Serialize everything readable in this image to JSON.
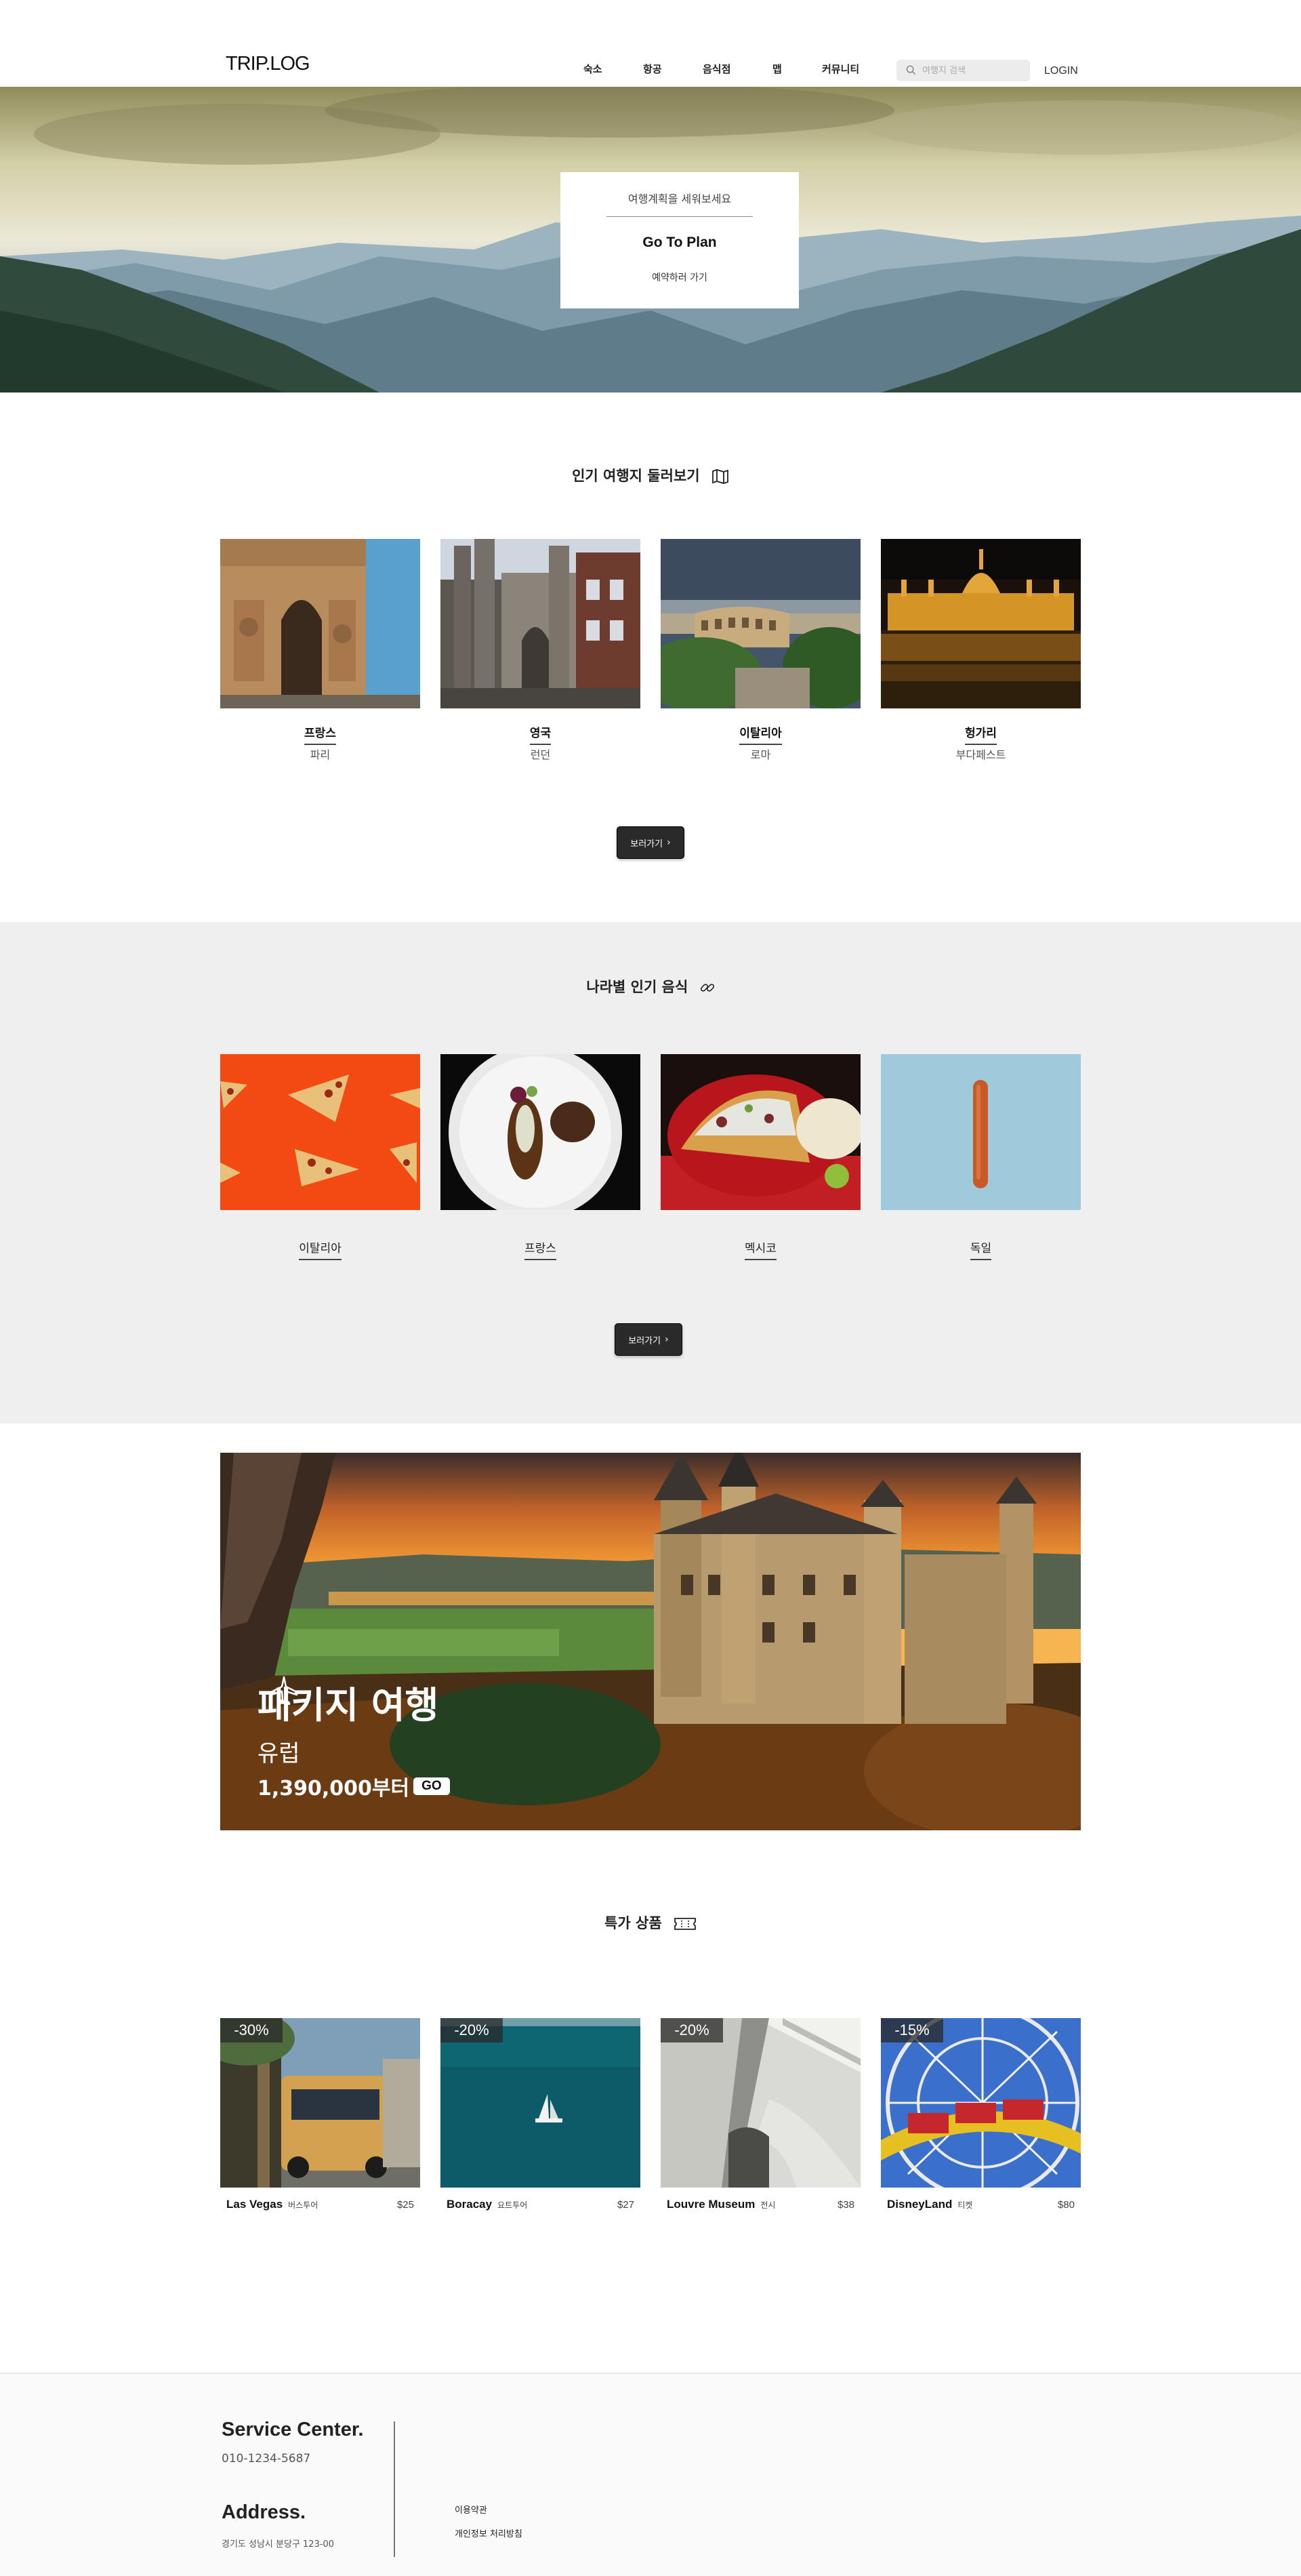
{
  "header": {
    "logo": "TRIP.LOG",
    "nav": [
      "숙소",
      "항공",
      "음식점",
      "맵",
      "커뮤니티"
    ],
    "search_placeholder": "여행지 검색",
    "login": "LOGIN"
  },
  "hero": {
    "subtitle": "여행계획을 세워보세요",
    "title": "Go To Plan",
    "link": "예약하러 가기"
  },
  "popular": {
    "title": "인기 여행지 둘러보기",
    "items": [
      {
        "country": "프랑스",
        "city": "파리"
      },
      {
        "country": "영국",
        "city": "런던"
      },
      {
        "country": "이탈리아",
        "city": "로마"
      },
      {
        "country": "헝가리",
        "city": "부다페스트"
      }
    ],
    "button": "보러가기"
  },
  "food": {
    "title": "나라별 인기 음식",
    "items": [
      "이탈리아",
      "프랑스",
      "멕시코",
      "독일"
    ],
    "button": "보러가기"
  },
  "package": {
    "title": "패키지 여행",
    "region": "유럽",
    "price": "1,390,000부터",
    "go": "GO"
  },
  "deals": {
    "title": "특가 상품",
    "items": [
      {
        "discount": "-30%",
        "name": "Las Vegas",
        "type": "버스투어",
        "price": "$25"
      },
      {
        "discount": "-20%",
        "name": "Boracay",
        "type": "요트투어",
        "price": "$27"
      },
      {
        "discount": "-20%",
        "name": "Louvre Museum",
        "type": "전시",
        "price": "$38"
      },
      {
        "discount": "-15%",
        "name": "DisneyLand",
        "type": "티켓",
        "price": "$80"
      }
    ]
  },
  "footer": {
    "service_heading": "Service Center.",
    "phone": "010-1234-5687",
    "address_heading": "Address.",
    "address": "경기도 성남시 분당구 123-00",
    "links": [
      "이용약관",
      "개인정보 처리방침"
    ]
  }
}
